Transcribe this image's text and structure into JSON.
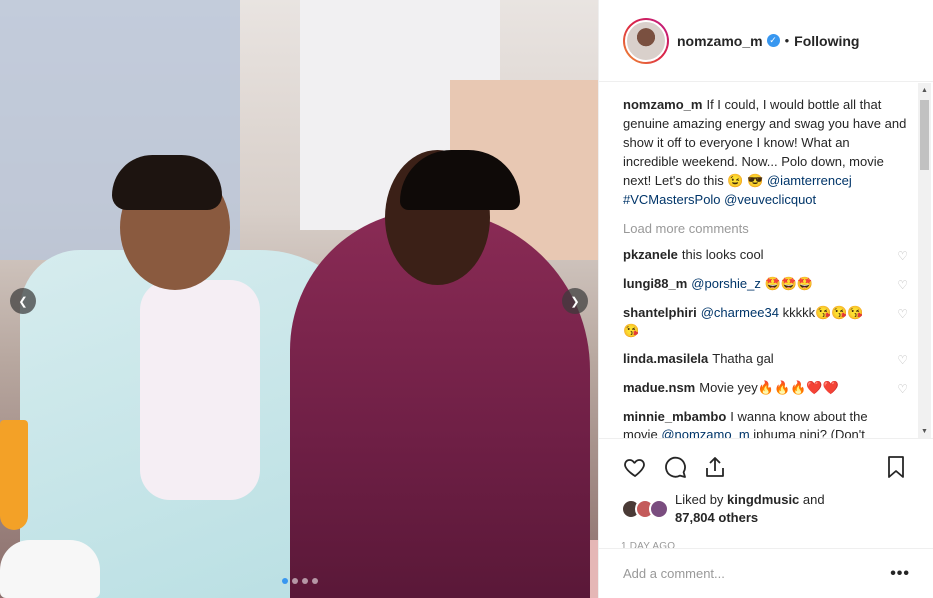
{
  "post": {
    "username": "nomzamo_m",
    "follow_status": "Following",
    "bullet": "•"
  },
  "media": {
    "prev_glyph": "❮",
    "next_glyph": "❯",
    "dots": 4,
    "active_dot": 0
  },
  "caption": {
    "username": "nomzamo_m",
    "text": "If I could, I would bottle all that genuine amazing energy and swag you have and show it off to everyone I know! What an incredible weekend. Now... Polo down, movie next! Let's do this 😉 😎",
    "mention": "@iamterrencej",
    "hashtag": "#VCMastersPolo",
    "mention2": "@veuveclicquot"
  },
  "load_more": "Load more comments",
  "comments": [
    {
      "username": "pkzanele",
      "text": "this looks cool"
    },
    {
      "username": "lungi88_m",
      "text": "🤩🤩🤩",
      "mention": "@porshie_z"
    },
    {
      "username": "shantelphiri",
      "text": "kkkkk😘😘😘😘",
      "mention": "@charmee34"
    },
    {
      "username": "linda.masilela",
      "text": "Thatha gal"
    },
    {
      "username": "madue.nsm",
      "text": "Movie yey🔥🔥🔥❤️❤️"
    },
    {
      "username": "minnie_mbambo",
      "text": "I wanna know about the movie",
      "mention": "@nomzamo_m",
      "text2": "iphuma nini? (Don't make us wait for too long"
    }
  ],
  "likes": {
    "prefix": "Liked by",
    "user": "kingdmusic",
    "and": "and",
    "others": "87,804 others"
  },
  "time": "1 DAY AGO",
  "add_comment_placeholder": "Add a comment...",
  "more_glyph": "•••",
  "colors": {
    "accent": "#3897f0",
    "link": "#003569",
    "muted": "#999999"
  },
  "icons": {
    "like": "heart-icon",
    "comment": "comment-icon",
    "share": "share-icon",
    "save": "bookmark-icon",
    "verified": "verified-badge-icon"
  }
}
